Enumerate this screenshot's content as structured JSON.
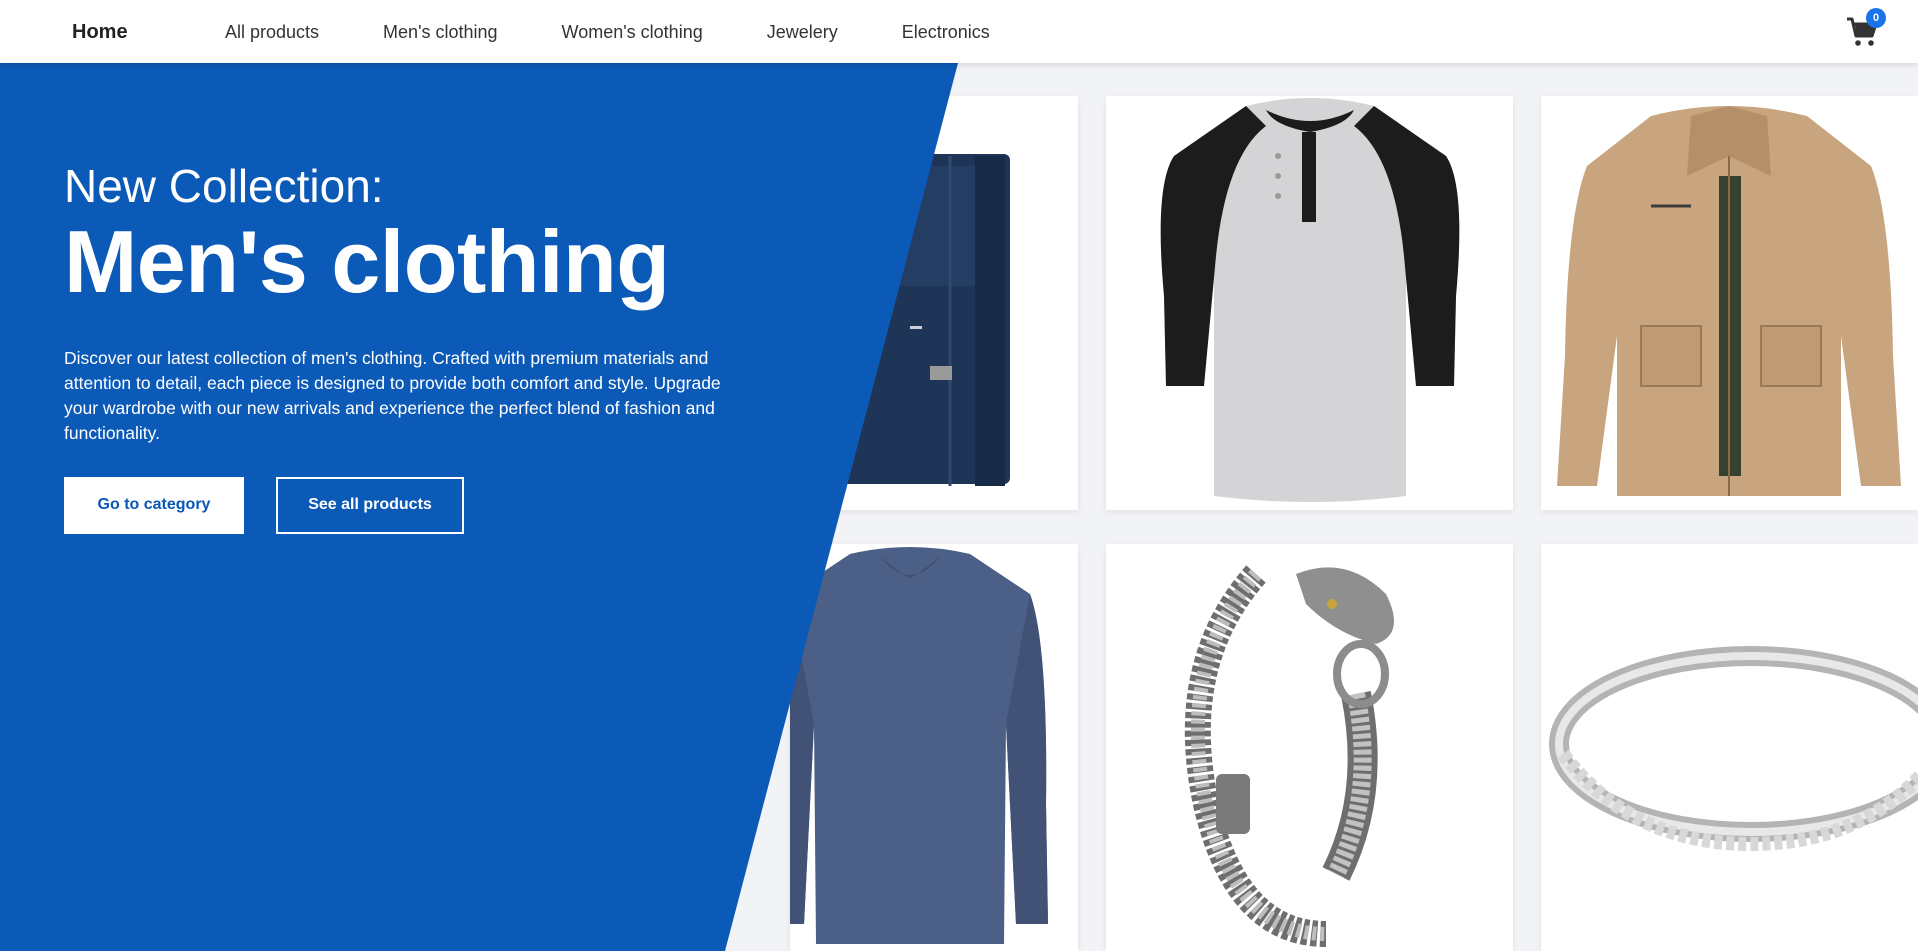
{
  "nav": {
    "brand": "Home",
    "links": [
      "All products",
      "Men's clothing",
      "Women's clothing",
      "Jewelery",
      "Electronics"
    ],
    "cart_icon": "shopping-cart-icon",
    "cart_count": "0"
  },
  "hero": {
    "kicker": "New Collection:",
    "title": "Men's clothing",
    "description": "Discover our latest collection of men's clothing. Crafted with premium materials and attention to detail, each piece is designed to provide both comfort and style. Upgrade your wardrobe with our new arrivals and experience the perfect blend of fashion and functionality.",
    "primary_button": "Go to category",
    "secondary_button": "See all products",
    "color": "#0b5ab8"
  },
  "products": [
    {
      "name": "navy-backpack-image"
    },
    {
      "name": "henley-raglan-shirt-image"
    },
    {
      "name": "khaki-jacket-image"
    },
    {
      "name": "long-sleeve-tshirt-image"
    },
    {
      "name": "dragon-bracelet-image"
    },
    {
      "name": "silver-ring-image"
    }
  ]
}
